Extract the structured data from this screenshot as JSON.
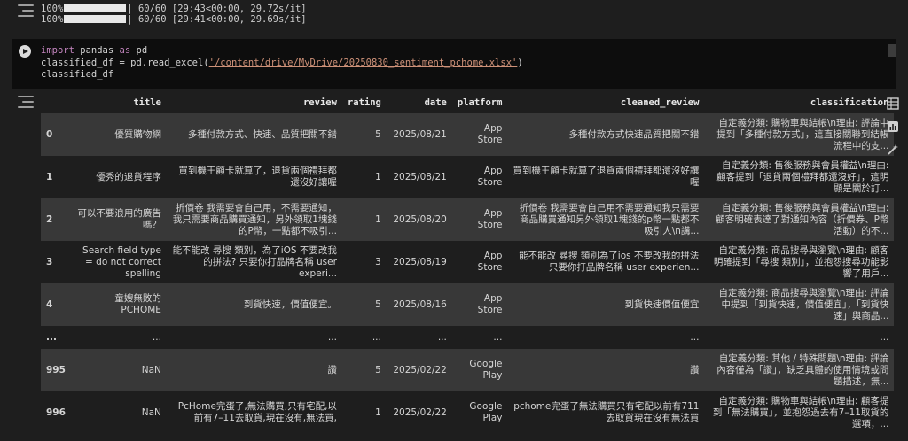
{
  "progress": [
    {
      "pct": "100%",
      "text": "| 60/60 [29:43<00:00, 29.72s/it]"
    },
    {
      "pct": "100%",
      "text": "| 60/60 [29:41<00:00, 29.69s/it]"
    }
  ],
  "code": {
    "line1_kw": "import",
    "line1_rest": " pandas ",
    "line1_kw2": "as",
    "line1_end": " pd",
    "line2_start": "classified_df = pd.read_excel(",
    "line2_str": "'/content/drive/MyDrive/20250830_sentiment_pchome.xlsx'",
    "line2_end": ")",
    "line3": "classified_df"
  },
  "table": {
    "headers": [
      "title",
      "review",
      "rating",
      "date",
      "platform",
      "cleaned_review",
      "classification"
    ],
    "rows": [
      {
        "idx": "0",
        "title": "優質購物網",
        "review": "多種付款方式、快速、品質把關不錯",
        "rating": "5",
        "date": "2025/08/21",
        "platform": "App Store",
        "cleaned": "多種付款方式快速品質把關不錯",
        "classification": "自定義分類: 購物車與結帳\\n理由: 評論中提到「多種付款方式」，這直接關聯到結帳流程中的支..."
      },
      {
        "idx": "1",
        "title": "優秀的退貨程序",
        "review": "買到機王顧卡就算了，退貨兩個禮拜都還沒好讓喔",
        "rating": "1",
        "date": "2025/08/21",
        "platform": "App Store",
        "cleaned": "買到機王顧卡就算了退貨兩個禮拜都還沒好讓喔",
        "classification": "自定義分類: 售後服務與會員權益\\n理由: 顧客提到「退貨兩個禮拜都還沒好」，這明顯是關於訂..."
      },
      {
        "idx": "2",
        "title": "可以不要浪用的廣告嗎？",
        "review": "折價卷 我需要會自己用，不需要通知，我只需要商品購買通知，另外領取1塊錢的P幣，一點都不吸引...",
        "rating": "1",
        "date": "2025/08/20",
        "platform": "App Store",
        "cleaned": "折價卷 我需要會自己用不需要通知我只需要商品購買通知另外領取1塊錢的p幣一點都不吸引人\\n講...",
        "classification": "自定義分類: 售後服務與會員權益\\n理由: 顧客明確表達了對通知內容（折價券、P幣活動）的不..."
      },
      {
        "idx": "3",
        "title": "Search field type = do not correct spelling",
        "review": "能不能改 尋搜 類別，為了iOS 不要改我的拼法? 只要你打品牌名稱 user experi...",
        "rating": "3",
        "date": "2025/08/19",
        "platform": "App Store",
        "cleaned": "能不能改 尋搜 類別為了ios 不要改我的拼法 只要你打品牌名稱 user experien...",
        "classification": "自定義分類: 商品搜尋與瀏覽\\n理由: 顧客明確提到「尋搜 類別」，並抱怨搜尋功能影響了用戶..."
      },
      {
        "idx": "4",
        "title": "童嫂無敗的PCHOME",
        "review": "到貨快速，價值便宜。",
        "rating": "5",
        "date": "2025/08/16",
        "platform": "App Store",
        "cleaned": "到貨快速價值便宜",
        "classification": "自定義分類: 商品搜尋與瀏覽\\n理由: 評論中提到「到貨快速，價值便宜」，「到貨快速」與商品..."
      },
      {
        "idx": "...",
        "title": "...",
        "review": "...",
        "rating": "...",
        "date": "...",
        "platform": "...",
        "cleaned": "...",
        "classification": "..."
      },
      {
        "idx": "995",
        "title": "NaN",
        "review": "讚",
        "rating": "5",
        "date": "2025/02/22",
        "platform": "Google Play",
        "cleaned": "讚",
        "classification": "自定義分類: 其他 / 特殊問題\\n理由: 評論內容僅為「讚」，缺乏具體的使用情境或問題描述，無..."
      },
      {
        "idx": "996",
        "title": "NaN",
        "review": "PcHome完蛋了,無法購買,只有宅配,以前有7–11去取貨,現在沒有,無法買,",
        "rating": "1",
        "date": "2025/02/22",
        "platform": "Google Play",
        "cleaned": "pchome完蛋了無法購買只有宅配以前有711去取貨現在沒有無法買",
        "classification": "自定義分類: 購物車與結帳\\n理由: 顧客提到「無法購買」，並抱怨過去有7–11取貨的選項，..."
      }
    ]
  }
}
